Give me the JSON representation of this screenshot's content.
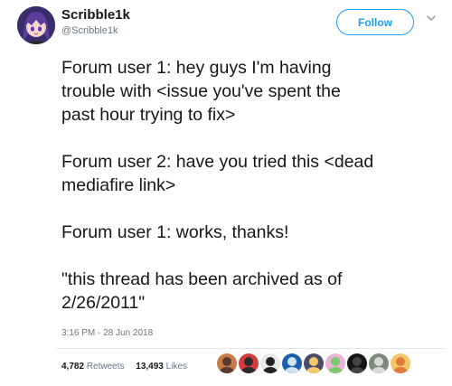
{
  "tweet": {
    "display_name": "Scribble1k",
    "handle": "@Scribble1k",
    "follow_label": "Follow",
    "text_lines": [
      "Forum user 1: hey guys I'm having",
      "trouble with <issue you've spent the",
      "past hour trying to fix>",
      "Forum user 2: have you tried this <dead",
      "mediafire link>",
      "Forum user 1: works,  thanks!",
      "\"this thread has been archived as of",
      "2/26/2011\""
    ],
    "timestamp": "3:16 PM - 28 Jun 2018",
    "retweets_count": "4,782",
    "retweets_label": "Retweets",
    "likes_count": "13,493",
    "likes_label": "Likes"
  },
  "colors": {
    "accent": "#1da1f2",
    "secondary_text": "#657786",
    "primary_text": "#14171a"
  },
  "icons": {
    "caret": "chevron-down-icon",
    "avatar": "anime-avatar"
  },
  "likers": [
    {
      "name": "liker-avatar-1",
      "bg": "#c87a4a",
      "fg": "#5a3a2a"
    },
    {
      "name": "liker-avatar-2",
      "bg": "#d43b3b",
      "fg": "#2b2b2b"
    },
    {
      "name": "liker-avatar-3",
      "bg": "#eaeaea",
      "fg": "#222222"
    },
    {
      "name": "liker-avatar-4",
      "bg": "#1d5fa8",
      "fg": "#cfe3f5"
    },
    {
      "name": "liker-avatar-5",
      "bg": "#4b4b6e",
      "fg": "#f2c96b"
    },
    {
      "name": "liker-avatar-6",
      "bg": "#e9b4d6",
      "fg": "#7ec86f"
    },
    {
      "name": "liker-avatar-7",
      "bg": "#141414",
      "fg": "#444444"
    },
    {
      "name": "liker-avatar-8",
      "bg": "#7d8a7b",
      "fg": "#d9d9d9"
    },
    {
      "name": "liker-avatar-9",
      "bg": "#f3c66a",
      "fg": "#e07a3a"
    }
  ]
}
